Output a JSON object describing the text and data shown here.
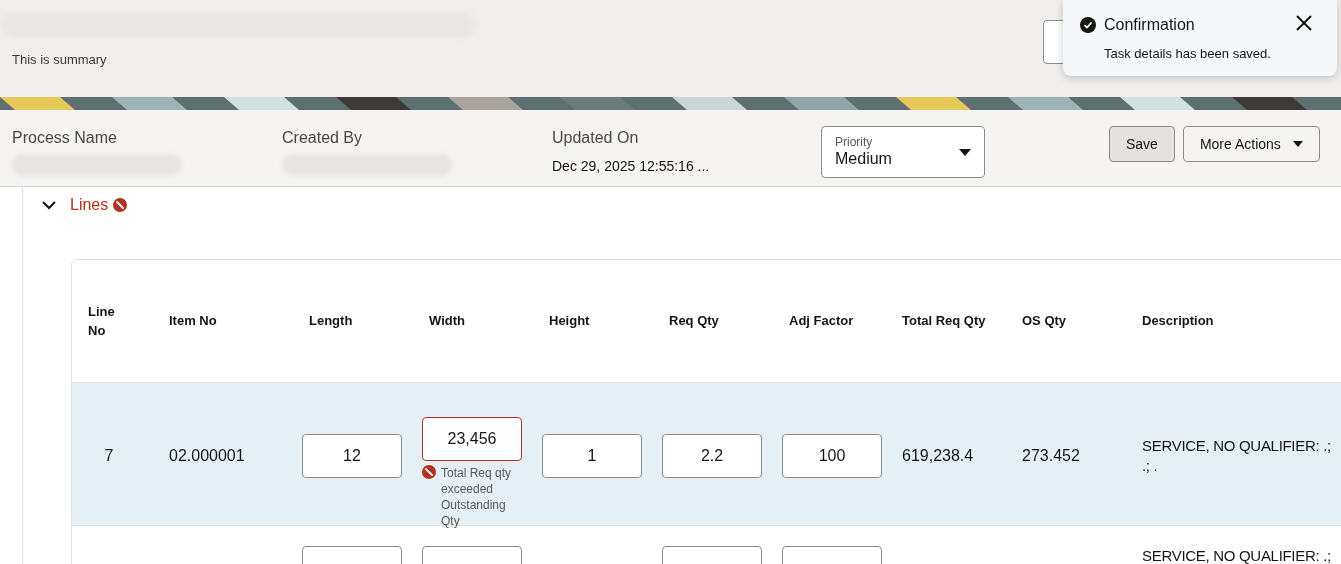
{
  "header": {
    "summary": "This is summary"
  },
  "toast": {
    "title": "Confirmation",
    "message": "Task details has been saved."
  },
  "info": [
    {
      "label": "Process Name"
    },
    {
      "label": "Created By"
    },
    {
      "label": "Updated On",
      "value": "Dec 29, 2025 12:55:16 ..."
    }
  ],
  "priority": {
    "label": "Priority",
    "value": "Medium"
  },
  "actions": [
    {
      "label": "Save",
      "kind": "plain"
    },
    {
      "label": "More Actions",
      "kind": "menu"
    }
  ],
  "section": {
    "title": "Lines",
    "expanded": true,
    "has_error": true
  },
  "table": {
    "columns": [
      {
        "label": "Line No"
      },
      {
        "label": "Item No"
      },
      {
        "label": "Length"
      },
      {
        "label": "Width"
      },
      {
        "label": "Height"
      },
      {
        "label": "Req Qty"
      },
      {
        "label": "Adj Factor"
      },
      {
        "label": "Total Req Qty"
      },
      {
        "label": "OS Qty"
      },
      {
        "label": "Description"
      }
    ],
    "rows": [
      {
        "selected": true,
        "cells": [
          {
            "kind": "text",
            "value": "7"
          },
          {
            "kind": "text",
            "value": "02.000001"
          },
          {
            "kind": "input",
            "value": "12"
          },
          {
            "kind": "input",
            "value": "23,456",
            "error": "Total Req qty exceeded Outstanding Qty"
          },
          {
            "kind": "input",
            "value": "1"
          },
          {
            "kind": "input",
            "value": "2.2"
          },
          {
            "kind": "input",
            "value": "100"
          },
          {
            "kind": "text",
            "value": "619,238.4"
          },
          {
            "kind": "text",
            "value": "273.452"
          },
          {
            "kind": "text",
            "value": "SERVICE, NO QUALIFIER: .; .; ."
          }
        ]
      },
      {
        "selected": false,
        "cells": [
          {
            "kind": "empty"
          },
          {
            "kind": "empty"
          },
          {
            "kind": "input"
          },
          {
            "kind": "input"
          },
          {
            "kind": "empty"
          },
          {
            "kind": "input"
          },
          {
            "kind": "input"
          },
          {
            "kind": "empty"
          },
          {
            "kind": "empty"
          },
          {
            "kind": "text",
            "value": "SERVICE, NO QUALIFIER: .;"
          }
        ]
      }
    ]
  }
}
